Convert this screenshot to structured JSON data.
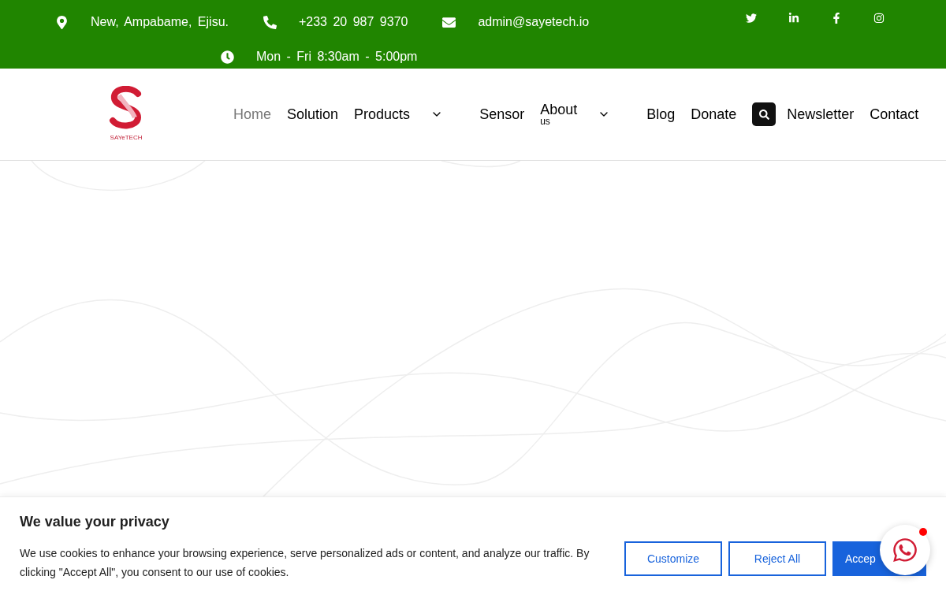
{
  "topbar": {
    "contacts": [
      {
        "kind": "location",
        "text": "New, Ampabame, Ejisu."
      },
      {
        "kind": "phone",
        "text": "+233 20 987 9370"
      },
      {
        "kind": "email",
        "text": "admin@sayetech.io"
      },
      {
        "kind": "hours",
        "text": "Mon - Fri 8:30am - 5:00pm"
      }
    ],
    "social": [
      {
        "kind": "twitter"
      },
      {
        "kind": "linkedin"
      },
      {
        "kind": "facebook"
      },
      {
        "kind": "instagram"
      }
    ]
  },
  "header": {
    "logo": {
      "text": "SAYeTECH"
    },
    "nav": [
      {
        "label": "Home",
        "selected": true,
        "dropdown": false
      },
      {
        "label": "Solution",
        "selected": false,
        "dropdown": false
      },
      {
        "label": "Products",
        "selected": false,
        "dropdown": true
      },
      {
        "label": "Sensor",
        "selected": false,
        "dropdown": false
      },
      {
        "label": "About",
        "sublabel": "us",
        "selected": false,
        "dropdown": true
      },
      {
        "label": "Blog",
        "selected": false,
        "dropdown": false
      },
      {
        "label": "Donate",
        "selected": false,
        "dropdown": false
      },
      {
        "label": "Newsletter",
        "selected": false,
        "dropdown": false
      },
      {
        "label": "Contact",
        "selected": false,
        "dropdown": false
      }
    ]
  },
  "cookie_banner": {
    "title": "We value your privacy",
    "text": "We use cookies to enhance your browsing experience, serve personalized ads or content, and analyze our traffic. By clicking \"Accept All\", you consent to our use of cookies.",
    "buttons": [
      {
        "kind": "outline",
        "label": "Customize"
      },
      {
        "kind": "outline",
        "label": "Reject All"
      },
      {
        "kind": "primary",
        "label": "Accep"
      }
    ]
  },
  "chat_button": {
    "notification": true
  }
}
